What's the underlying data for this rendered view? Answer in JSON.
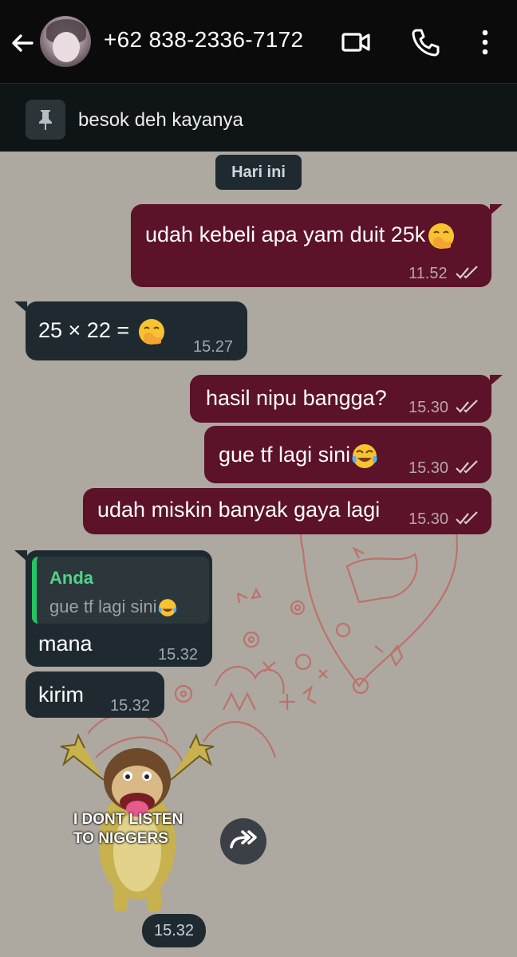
{
  "header": {
    "title": "+62 838-2336-7172",
    "icons": [
      "back-arrow-icon",
      "video-call-icon",
      "voice-call-icon",
      "more-options-icon"
    ]
  },
  "pinned": {
    "icon": "pin-icon",
    "text": "besok deh kayanya"
  },
  "date_chip": "Hari ini",
  "messages": [
    {
      "direction": "out",
      "text": "udah kebeli apa yam duit 25k",
      "emoji": "hand-over-mouth",
      "time": "11.52",
      "status": "read"
    },
    {
      "direction": "in",
      "text": "25 × 22 = ",
      "emoji": "hand-over-mouth",
      "time": "15.27"
    },
    {
      "direction": "out",
      "text": "hasil nipu bangga?",
      "time": "15.30",
      "status": "read"
    },
    {
      "direction": "out",
      "text": "gue tf lagi sini",
      "emoji": "tears-of-joy",
      "time": "15.30",
      "status": "read"
    },
    {
      "direction": "out",
      "text": "udah miskin banyak gaya lagi",
      "time": "15.30",
      "status": "read"
    },
    {
      "direction": "in",
      "quote": {
        "name": "Anda",
        "text": "gue tf lagi sini"
      },
      "text": "mana",
      "time": "15.32"
    },
    {
      "direction": "in",
      "text": "kirim",
      "time": "15.32"
    },
    {
      "direction": "in",
      "type": "sticker",
      "caption": "I DONT LISTEN\nTO NIGGERS",
      "time": "15.32"
    }
  ],
  "colors": {
    "background": "#ada9a0",
    "outgoing_bubble": "#5c1228",
    "incoming_bubble": "#1f2a30",
    "quote_bar": "#25c564",
    "header": "#0b0b0c"
  }
}
